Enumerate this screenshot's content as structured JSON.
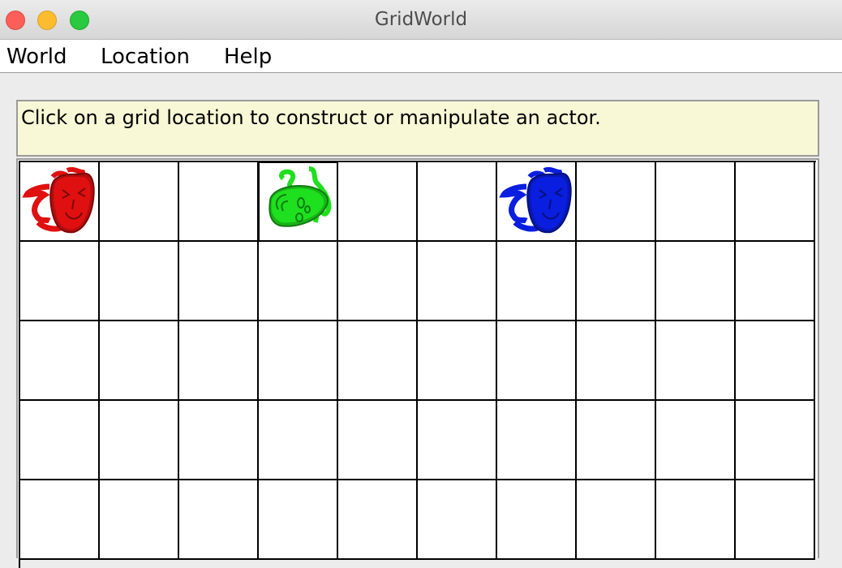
{
  "window": {
    "title": "GridWorld",
    "controls": [
      "close",
      "minimize",
      "zoom"
    ]
  },
  "menu": {
    "items": [
      "World",
      "Location",
      "Help"
    ]
  },
  "message": "Click on a grid location to construct or manipulate an actor.",
  "grid": {
    "visible_rows": 5,
    "visible_cols": 10,
    "selected": {
      "row": 0,
      "col": 3
    },
    "actors": [
      {
        "row": 0,
        "col": 0,
        "color": "#e01010",
        "icon": "mask-icon",
        "kind": "mask"
      },
      {
        "row": 0,
        "col": 3,
        "color": "#1ee01e",
        "icon": "mask-tilted-icon",
        "kind": "mask-tilted"
      },
      {
        "row": 0,
        "col": 6,
        "color": "#0a1ee0",
        "icon": "mask-icon",
        "kind": "mask"
      }
    ]
  }
}
